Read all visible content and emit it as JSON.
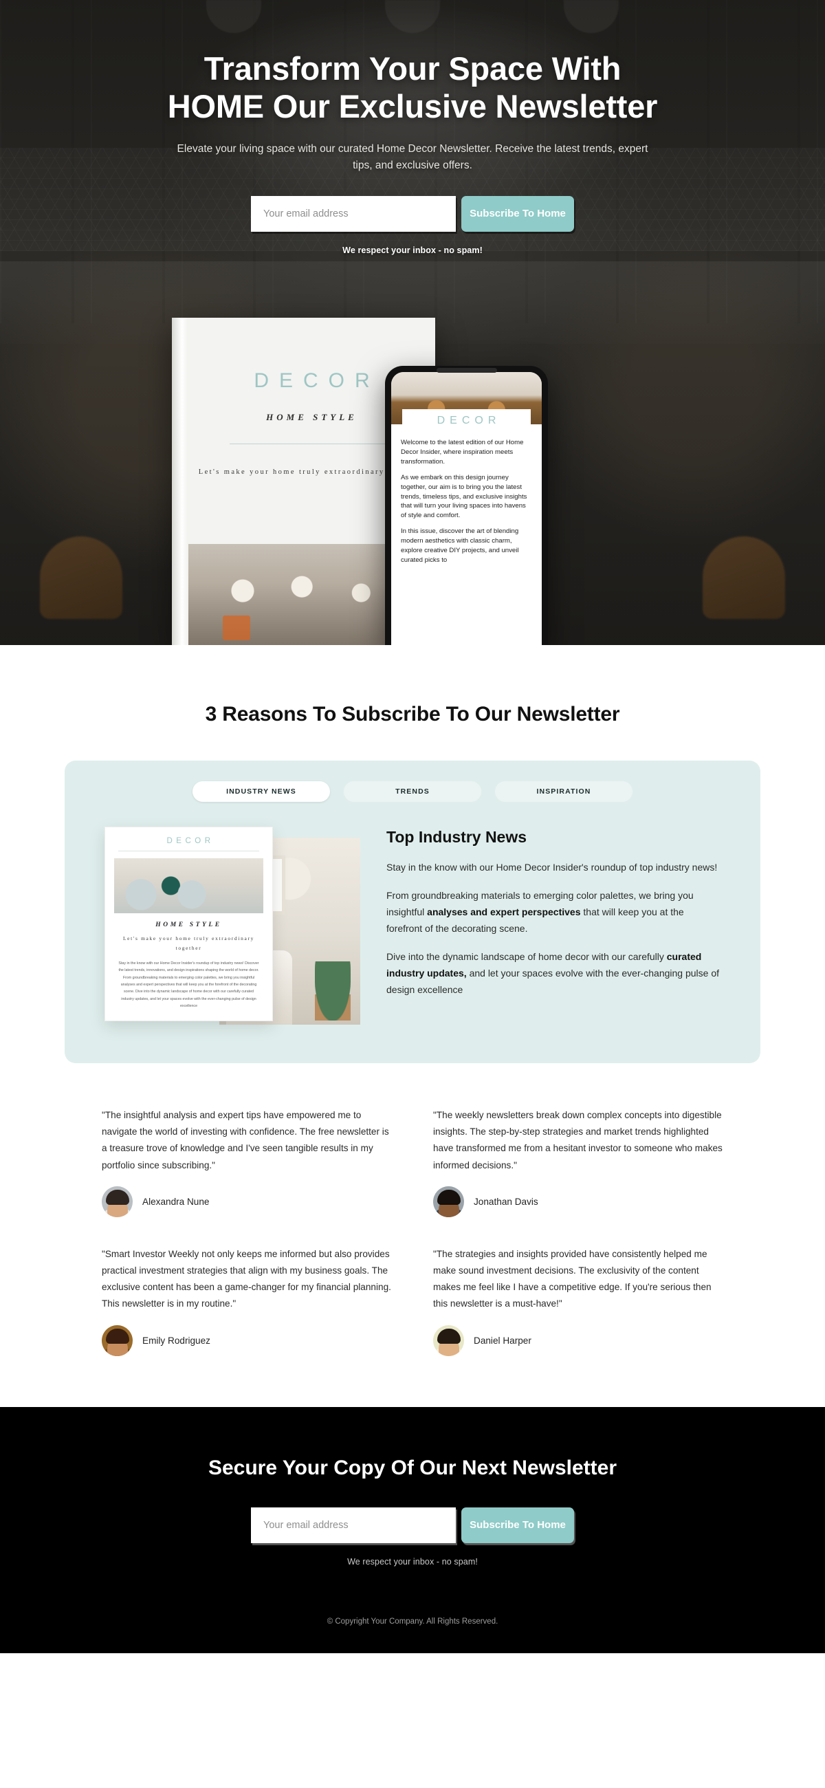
{
  "hero": {
    "title_line1": "Transform Your Space With",
    "title_line2": "HOME Our Exclusive Newsletter",
    "subtitle": "Elevate your living space with our curated Home Decor Newsletter. Receive the latest trends, expert tips, and exclusive offers.",
    "email_placeholder": "Your email address",
    "email_value": "",
    "subscribe_label": "Subscribe To Home",
    "nospam": "We respect your inbox - no spam!",
    "book": {
      "brand": "DECOR",
      "subtitle": "HOME STYLE",
      "tagline": "Let's make your home truly extraordinary together"
    },
    "phone": {
      "brand": "DECOR",
      "paragraph1": "Welcome to the latest edition of our Home Decor Insider, where inspiration meets transformation.",
      "paragraph2": "As we embark on this design journey together, our aim is to bring you the latest trends, timeless tips, and exclusive insights that will turn your living spaces into havens of style and comfort.",
      "paragraph3": "In this issue, discover the art of blending modern aesthetics with classic charm, explore creative DIY projects, and unveil curated picks to"
    }
  },
  "reasons": {
    "section_title": "3 Reasons To Subscribe To Our Newsletter",
    "tabs": [
      {
        "label": "INDUSTRY NEWS",
        "active": true
      },
      {
        "label": "TRENDS",
        "active": false
      },
      {
        "label": "INSPIRATION",
        "active": false
      }
    ],
    "panel": {
      "heading": "Top Industry News",
      "paragraph1": "Stay in the know with our Home Decor Insider's roundup of top industry news!",
      "paragraph2_pre": "From groundbreaking materials to emerging color palettes, we bring you insightful ",
      "paragraph2_bold": "analyses and expert perspectives",
      "paragraph2_post": " that will keep you at the forefront of the decorating scene.",
      "paragraph3_pre": "Dive into the dynamic landscape of home decor with our carefully ",
      "paragraph3_bold": "curated industry updates,",
      "paragraph3_post": " and let your spaces evolve with the ever-changing pulse of design excellence"
    },
    "preview_card": {
      "brand": "DECOR",
      "subtitle": "HOME STYLE",
      "tagline": "Let's make your home truly extraordinary together",
      "body": "Stay in the know with our Home Decor Insider's roundup of top industry news! Discover the latest trends, innovations, and design inspirations shaping the world of home decor. From groundbreaking materials to emerging color palettes, we bring you insightful analyses and expert perspectives that will keep you at the forefront of the decorating scene. Dive into the dynamic landscape of home decor with our carefully curated industry updates, and let your spaces evolve with the ever-changing pulse of design excellence"
    }
  },
  "testimonials": [
    {
      "quote": "\"The insightful analysis and expert tips have empowered me to navigate the world of investing with confidence. The free newsletter is a treasure trove of knowledge and I've seen tangible results in my portfolio since subscribing.\"",
      "name": "Alexandra Nune"
    },
    {
      "quote": "\"The weekly newsletters break down complex concepts into digestible insights. The step-by-step strategies and market trends highlighted have transformed me from a hesitant investor to someone who makes informed decisions.\"",
      "name": "Jonathan Davis"
    },
    {
      "quote": "\"Smart Investor Weekly not only keeps me informed but also provides practical investment strategies that align with my business goals. The exclusive content has been a game-changer for my financial planning. This newsletter is in my routine.\"",
      "name": "Emily Rodriguez"
    },
    {
      "quote": "\"The strategies and insights provided have consistently helped me make sound investment decisions. The exclusivity of the content makes me feel like I have a competitive edge. If you're serious then this newsletter is a must-have!\"",
      "name": "Daniel Harper"
    }
  ],
  "footer": {
    "title": "Secure Your Copy Of Our Next Newsletter",
    "email_placeholder": "Your email address",
    "email_value": "",
    "subscribe_label": "Subscribe To Home",
    "nospam": "We respect your inbox - no spam!",
    "copyright": "© Copyright Your Company. All Rights Reserved."
  },
  "colors": {
    "accent_teal": "#8fcbc8",
    "panel_mint": "#dfeeec",
    "footer_bg": "#000000",
    "decor_text": "#9ec6c4"
  }
}
